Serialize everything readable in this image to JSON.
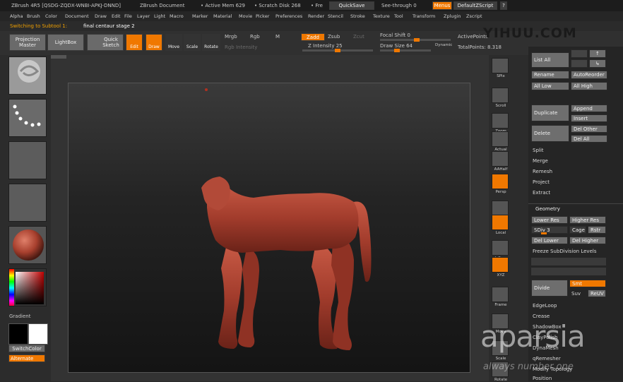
{
  "title_bar": {
    "app": "ZBrush 4R5 [QSDG-ZQDX-WNBI-APKJ-DNND]",
    "document": "ZBrush Document",
    "active_mem": "• Active Mem 629",
    "scratch_disk": "• Scratch Disk 268",
    "free": "• Fre",
    "quicksave": "QuickSave",
    "see_through": "See-through  0",
    "menus": "Menus",
    "default_script": "DefaultZScript"
  },
  "menu": [
    "Alpha",
    "Brush",
    "Color",
    "Document",
    "Draw",
    "Edit",
    "File",
    "Layer",
    "Light",
    "Macro",
    "Marker",
    "Material",
    "Movie",
    "Picker",
    "Preferences",
    "Render",
    "Stencil",
    "Stroke",
    "Texture",
    "Tool",
    "Transform",
    "Zplugin",
    "Zscript"
  ],
  "notice": {
    "label": "Switching to Subtool 1:",
    "value": "final centaur stage 2"
  },
  "toolbar": {
    "projection_master": "Projection Master",
    "lightbox": "LightBox",
    "quick_sketch": "Quick Sketch",
    "edit": "Edit",
    "draw": "Draw",
    "move": "Move",
    "scale": "Scale",
    "rotate": "Rotate",
    "mrgb": "Mrgb",
    "rgb": "Rgb",
    "m": "M",
    "rgb_intensity": "Rgb Intensity",
    "zadd": "Zadd",
    "zsub": "Zsub",
    "zcut": "Zcut",
    "z_intensity": "Z Intensity 25",
    "focal_shift": "Focal Shift 0",
    "draw_size": "Draw Size 64",
    "dynamic": "Dynamic",
    "active_points": "ActivePoints",
    "total_points": "TotalPoints: 8.318"
  },
  "left_shelf": {
    "gradient": "Gradient",
    "switch_color": "SwitchColor",
    "alternate": "Alternate"
  },
  "right_shelf": [
    "SPix",
    "Scroll",
    "Zoom",
    "Actual",
    "AAHalf",
    "Persp",
    "Floor",
    "Local",
    "L.Sym",
    "XYZ",
    "Frame",
    "Move",
    "Scale",
    "Rotate"
  ],
  "subtool_panel": {
    "list_all": "List All",
    "rename": "Rename",
    "auto_reorder": "AutoReorder",
    "all_low": "All Low",
    "all_high": "All High",
    "duplicate": "Duplicate",
    "append": "Append",
    "insert": "Insert",
    "delete": "Delete",
    "del_other": "Del Other",
    "del_all": "Del All",
    "split": "Split",
    "merge": "Merge",
    "remesh": "Remesh",
    "project": "Project",
    "extract": "Extract"
  },
  "geometry_panel": {
    "header": "Geometry",
    "lower_res": "Lower Res",
    "higher_res": "Higher Res",
    "sdiv": "SDiv 3",
    "cage": "Cage",
    "rstr": "Rstr",
    "del_lower": "Del Lower",
    "del_higher": "Del Higher",
    "freeze": "Freeze SubDivision Levels",
    "divide": "Divide",
    "smt": "Smt",
    "suv": "Suv",
    "reuv": "ReUV",
    "edgeloop": "EdgeLoop",
    "crease": "Crease",
    "shadowbox": "ShadowBox",
    "clay_polish": "ClayPolish",
    "dynamesh": "DynaMesh",
    "qremesher": "qRemesher",
    "modify_topology": "Modify Topology",
    "position": "Position"
  },
  "watermarks": {
    "yihuu": "YIHUU.COM",
    "aparsia": "aparsia",
    "tagline": "always number one"
  },
  "colors": {
    "accent": "#f07800",
    "model": "#b24a38",
    "panel_bg": "#252525"
  }
}
